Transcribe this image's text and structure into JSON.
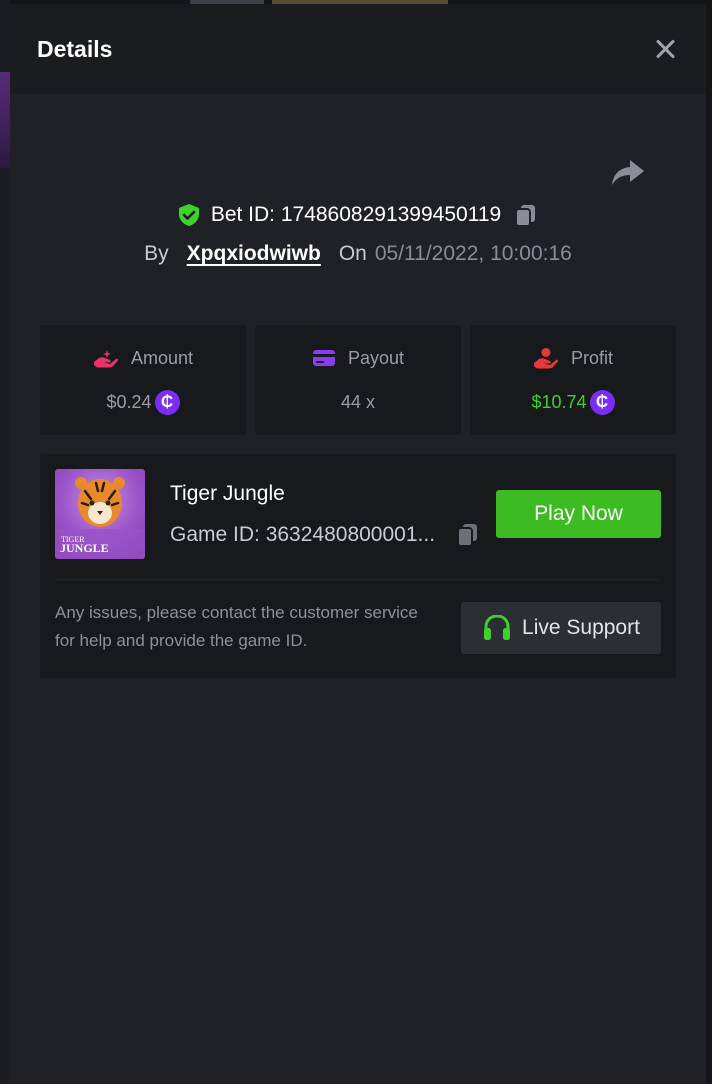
{
  "modal": {
    "title": "Details"
  },
  "bet": {
    "id_label": "Bet ID: 1748608291399450119",
    "by_label": "By",
    "username": "Xpqxiodwiwb",
    "on_label": "On",
    "datetime": "05/11/2022, 10:00:16"
  },
  "stats": {
    "amount": {
      "label": "Amount",
      "value": "$0.24"
    },
    "payout": {
      "label": "Payout",
      "value": "44 x"
    },
    "profit": {
      "label": "Profit",
      "value": "$10.74"
    }
  },
  "game": {
    "name": "Tiger Jungle",
    "id_label": "Game ID: 3632480800001...",
    "thumb_title_line1": "TIGER",
    "thumb_title_line2": "JUNGLE",
    "play_label": "Play Now",
    "support_text": "Any issues, please contact the customer service for help and provide the game ID.",
    "support_button": "Live Support"
  },
  "coin_symbol": "₵",
  "colors": {
    "accent_green": "#3cbc22",
    "profit_green": "#3ed12b",
    "coin_purple": "#7b2cf5",
    "amount_pink": "#e8336a",
    "payout_purple": "#8a3cf0",
    "profit_red": "#e23a3a"
  },
  "icons": {
    "close": "close-icon",
    "share": "share-icon",
    "shield": "shield-check-icon",
    "copy": "copy-icon",
    "amount": "hand-coin-icon",
    "payout": "card-icon",
    "profit": "hand-heart-icon",
    "support": "headset-icon"
  }
}
